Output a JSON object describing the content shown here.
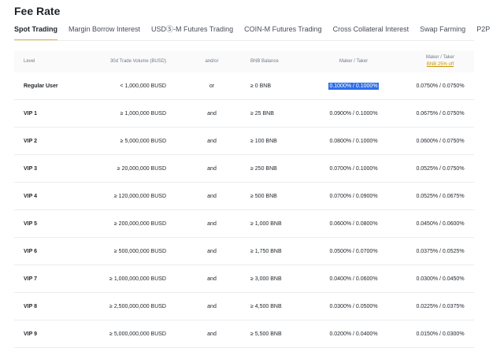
{
  "page": {
    "title": "Fee Rate"
  },
  "tabs": [
    {
      "label": "Spot Trading",
      "active": true
    },
    {
      "label": "Margin Borrow Interest",
      "active": false
    },
    {
      "label": "USDⓈ-M Futures Trading",
      "active": false
    },
    {
      "label": "COIN-M Futures Trading",
      "active": false
    },
    {
      "label": "Cross Collateral Interest",
      "active": false
    },
    {
      "label": "Swap Farming",
      "active": false
    },
    {
      "label": "P2P",
      "active": false
    }
  ],
  "table": {
    "headers": {
      "level": "Level",
      "volume": "30d Trade Volume (BUSD)",
      "andor": "and/or",
      "bnb": "BNB Balance",
      "maker_taker": "Maker / Taker",
      "maker_taker_bnb": "Maker / Taker",
      "bnb_discount": "BNB 25% off"
    },
    "rows": [
      {
        "level": "Regular User",
        "volume": "< 1,000,000 BUSD",
        "andor": "or",
        "bnb": "≥ 0 BNB",
        "rate": "0.1000% / 0.1000%",
        "rate_bnb": "0.0750% / 0.0750%"
      },
      {
        "level": "VIP 1",
        "volume": "≥ 1,000,000 BUSD",
        "andor": "and",
        "bnb": "≥ 25 BNB",
        "rate": "0.0900% / 0.1000%",
        "rate_bnb": "0.0675% / 0.0750%"
      },
      {
        "level": "VIP 2",
        "volume": "≥ 5,000,000 BUSD",
        "andor": "and",
        "bnb": "≥ 100 BNB",
        "rate": "0.0800% / 0.1000%",
        "rate_bnb": "0.0600% / 0.0750%"
      },
      {
        "level": "VIP 3",
        "volume": "≥ 20,000,000 BUSD",
        "andor": "and",
        "bnb": "≥ 250 BNB",
        "rate": "0.0700% / 0.1000%",
        "rate_bnb": "0.0525% / 0.0750%"
      },
      {
        "level": "VIP 4",
        "volume": "≥ 120,000,000 BUSD",
        "andor": "and",
        "bnb": "≥ 500 BNB",
        "rate": "0.0700% / 0.0900%",
        "rate_bnb": "0.0525% / 0.0675%"
      },
      {
        "level": "VIP 5",
        "volume": "≥ 200,000,000 BUSD",
        "andor": "and",
        "bnb": "≥ 1,000 BNB",
        "rate": "0.0600% / 0.0800%",
        "rate_bnb": "0.0450% / 0.0600%"
      },
      {
        "level": "VIP 6",
        "volume": "≥ 500,000,000 BUSD",
        "andor": "and",
        "bnb": "≥ 1,750 BNB",
        "rate": "0.0500% / 0.0700%",
        "rate_bnb": "0.0375% / 0.0525%"
      },
      {
        "level": "VIP 7",
        "volume": "≥ 1,000,000,000 BUSD",
        "andor": "and",
        "bnb": "≥ 3,000 BNB",
        "rate": "0.0400% / 0.0600%",
        "rate_bnb": "0.0300% / 0.0450%"
      },
      {
        "level": "VIP 8",
        "volume": "≥ 2,500,000,000 BUSD",
        "andor": "and",
        "bnb": "≥ 4,500 BNB",
        "rate": "0.0300% / 0.0500%",
        "rate_bnb": "0.0225% / 0.0375%"
      },
      {
        "level": "VIP 9",
        "volume": "≥ 5,000,000,000 BUSD",
        "andor": "and",
        "bnb": "≥ 5,500 BNB",
        "rate": "0.0200% / 0.0400%",
        "rate_bnb": "0.0150% / 0.0300%"
      }
    ]
  },
  "colors": {
    "accent": "#f0b90b",
    "selection": "#2e6fe8",
    "link": "#c99400"
  }
}
